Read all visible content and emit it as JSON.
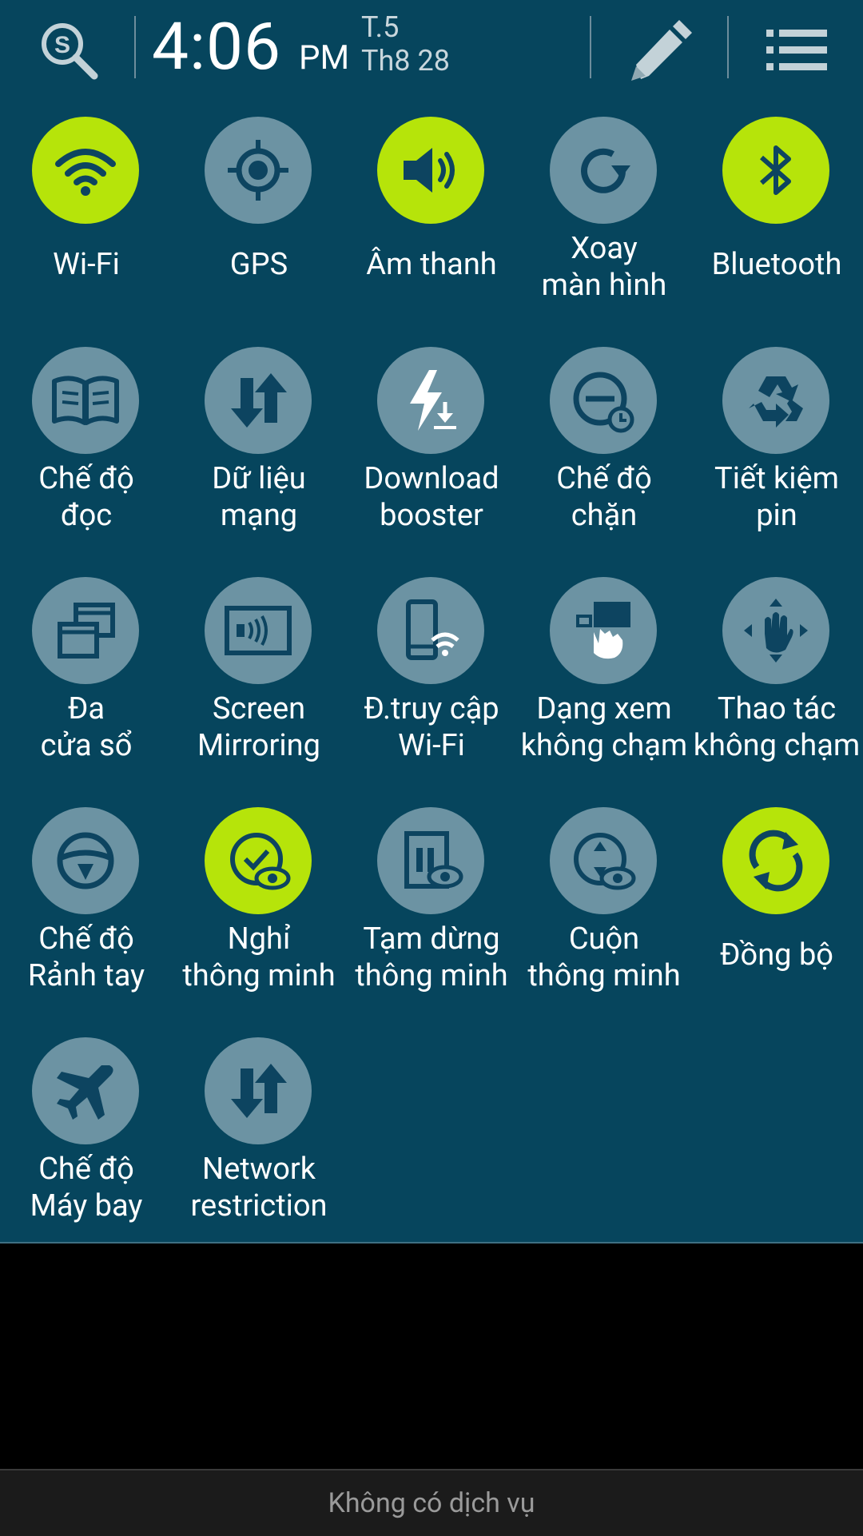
{
  "header": {
    "time": "4:06",
    "ampm": "PM",
    "day": "T.5",
    "date": "Th8 28",
    "search_icon": "s-finder-search-icon",
    "edit_icon": "pencil-icon",
    "list_icon": "list-icon"
  },
  "colors": {
    "panel_bg": "#06455d",
    "tile_off": "#6c93a3",
    "tile_on": "#b6e40a"
  },
  "tiles": [
    {
      "id": "wifi",
      "line1": "Wi-Fi",
      "line2": "",
      "on": true,
      "icon": "wifi-icon"
    },
    {
      "id": "gps",
      "line1": "GPS",
      "line2": "",
      "on": false,
      "icon": "gps-icon"
    },
    {
      "id": "sound",
      "line1": "Âm thanh",
      "line2": "",
      "on": true,
      "icon": "speaker-icon"
    },
    {
      "id": "rotate",
      "line1": "Xoay",
      "line2": "màn hình",
      "on": false,
      "icon": "rotate-icon"
    },
    {
      "id": "bluetooth",
      "line1": "Bluetooth",
      "line2": "",
      "on": true,
      "icon": "bluetooth-icon"
    },
    {
      "id": "reading",
      "line1": "Chế độ",
      "line2": "đọc",
      "on": false,
      "icon": "book-icon"
    },
    {
      "id": "data",
      "line1": "Dữ liệu",
      "line2": "mạng",
      "on": false,
      "icon": "data-arrows-icon"
    },
    {
      "id": "download",
      "line1": "Download",
      "line2": "booster",
      "on": false,
      "icon": "download-booster-icon"
    },
    {
      "id": "block",
      "line1": "Chế độ",
      "line2": "chặn",
      "on": false,
      "icon": "block-mode-icon"
    },
    {
      "id": "power",
      "line1": "Tiết kiệm",
      "line2": "pin",
      "on": false,
      "icon": "recycle-icon"
    },
    {
      "id": "multiwindow",
      "line1": "Đa",
      "line2": "cửa sổ",
      "on": false,
      "icon": "multi-window-icon"
    },
    {
      "id": "mirroring",
      "line1": "Screen",
      "line2": "Mirroring",
      "on": false,
      "icon": "screen-mirroring-icon"
    },
    {
      "id": "hotspot",
      "line1": "Đ.truy cập",
      "line2": "Wi-Fi",
      "on": false,
      "icon": "hotspot-icon"
    },
    {
      "id": "airview",
      "line1": "Dạng xem",
      "line2": "không chạm",
      "on": false,
      "icon": "air-view-icon"
    },
    {
      "id": "airgesture",
      "line1": "Thao tác",
      "line2": "không chạm",
      "on": false,
      "icon": "air-gesture-icon"
    },
    {
      "id": "handsfree",
      "line1": "Chế độ",
      "line2": "Rảnh tay",
      "on": false,
      "icon": "steering-wheel-icon"
    },
    {
      "id": "smartstay",
      "line1": "Nghỉ",
      "line2": "thông minh",
      "on": true,
      "icon": "smart-stay-icon"
    },
    {
      "id": "smartpause",
      "line1": "Tạm dừng",
      "line2": "thông minh",
      "on": false,
      "icon": "smart-pause-icon"
    },
    {
      "id": "smartscroll",
      "line1": "Cuộn",
      "line2": "thông minh",
      "on": false,
      "icon": "smart-scroll-icon"
    },
    {
      "id": "sync",
      "line1": "Đồng bộ",
      "line2": "",
      "on": true,
      "icon": "sync-icon"
    },
    {
      "id": "airplane",
      "line1": "Chế độ",
      "line2": "Máy bay",
      "on": false,
      "icon": "airplane-icon"
    },
    {
      "id": "netrestrict",
      "line1": "Network",
      "line2": "restriction",
      "on": false,
      "icon": "data-arrows-icon"
    }
  ],
  "footer": {
    "status": "Không có dịch vụ"
  }
}
